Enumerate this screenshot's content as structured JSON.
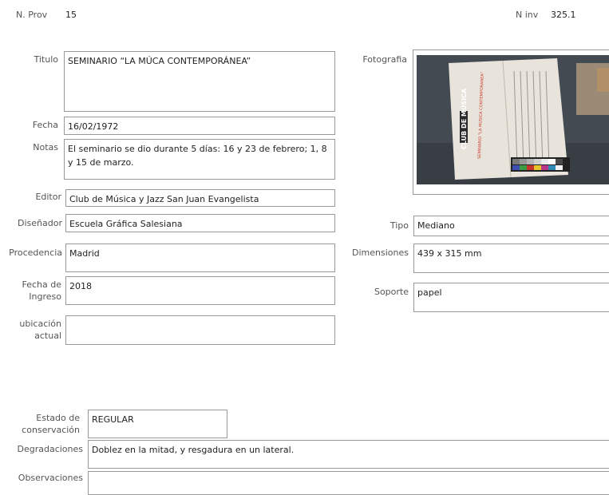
{
  "header": {
    "nprov_label": "N. Prov",
    "nprov_value": "15",
    "ninv_label": "N inv",
    "ninv_value": "325.1"
  },
  "form": {
    "titulo_label": "Titulo",
    "titulo_value": "SEMINARIO “LA MÚCA CONTEMPORÁNEA”",
    "fecha_label": "Fecha",
    "fecha_value": "16/02/1972",
    "notas_label": "Notas",
    "notas_value": "El seminario se dio durante 5 días: 16 y 23 de febrero; 1, 8 y 15 de marzo.",
    "editor_label": "Editor",
    "editor_value": "Club de Música y Jazz San Juan Evangelista",
    "disenador_label": "Diseñador",
    "disenador_value": "Escuela Gráfica Salesiana",
    "procedencia_label": "Procedencia",
    "procedencia_value": "Madrid",
    "fecha_ingreso_label_1": "Fecha de",
    "fecha_ingreso_label_2": "Ingreso",
    "fecha_ingreso_value": "2018",
    "ubicacion_label_1": "ubicación",
    "ubicacion_label_2": "actual",
    "ubicacion_value": "",
    "fotografia_label": "Fotografia",
    "tipo_label": "Tipo",
    "tipo_value": "Mediano",
    "dimensiones_label": "Dimensiones",
    "dimensiones_value": "439 x 315 mm",
    "soporte_label": "Soporte",
    "soporte_value": "papel",
    "estado_label_1": "Estado de",
    "estado_label_2": "conservación",
    "estado_value": "REGULAR",
    "degradaciones_label": "Degradaciones",
    "degradaciones_value": "Doblez en la mitad, y resgadura en un lateral.",
    "observaciones_label": "Observaciones",
    "observaciones_value": ""
  },
  "poster": {
    "vertical_text": "CLUB DE MÚSICA",
    "red_title": "SEMINARIO \"LA MUSICA CONTEMPORANEA\""
  }
}
